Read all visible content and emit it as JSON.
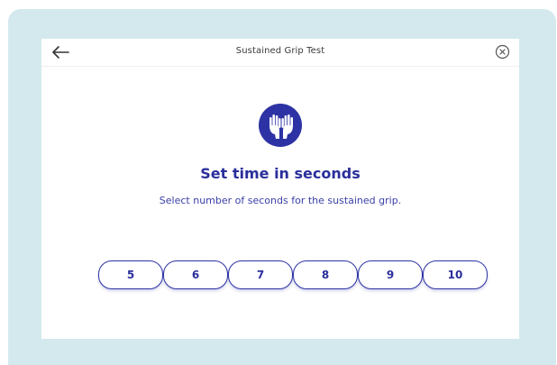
{
  "header": {
    "title": "Sustained Grip Test",
    "back_icon": "arrow-left-icon",
    "close_icon": "close-circle-icon"
  },
  "main": {
    "badge_icon": "raised-hands-icon",
    "heading": "Set time in seconds",
    "subtext": "Select number of seconds for the sustained grip.",
    "options": [
      "5",
      "6",
      "7",
      "8",
      "9",
      "10"
    ]
  },
  "colors": {
    "accent": "#2d33a4",
    "frame_background": "#d4e9ee",
    "screen_background": "#ffffff"
  }
}
